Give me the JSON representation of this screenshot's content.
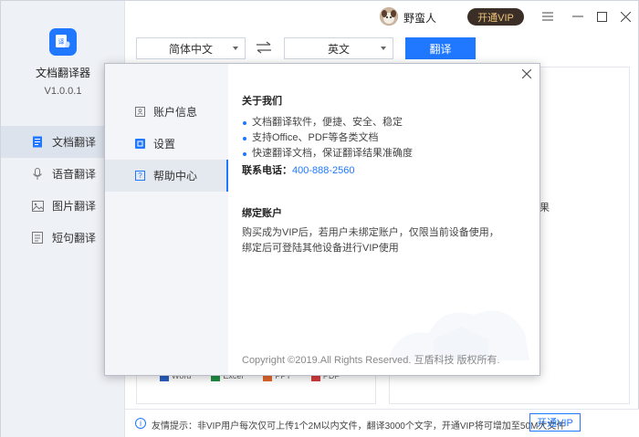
{
  "app": {
    "name": "文档翻译器",
    "version": "V1.0.0.1"
  },
  "sidebar": {
    "items": [
      {
        "label": "文档翻译",
        "icon": "document-icon",
        "active": true
      },
      {
        "label": "语音翻译",
        "icon": "microphone-icon",
        "active": false
      },
      {
        "label": "图片翻译",
        "icon": "image-icon",
        "active": false
      },
      {
        "label": "短句翻译",
        "icon": "text-icon",
        "active": false
      }
    ]
  },
  "titlebar": {
    "username": "野蛮人",
    "vip_label": "开通VIP"
  },
  "langbar": {
    "source": "简体中文",
    "target": "英文",
    "translate_label": "翻译"
  },
  "filetypes": [
    "Word",
    "Excel",
    "PPT",
    "PDF"
  ],
  "peek_text": "果",
  "tipbar": {
    "text": "友情提示：非VIP用户每次仅可上传1个2M以内文件，翻译3000个文字，开通VIP将可增加至50M大文件",
    "vip_label": "开通VIP"
  },
  "dialog": {
    "menu": [
      {
        "label": "账户信息",
        "icon": "account-icon",
        "active": false
      },
      {
        "label": "设置",
        "icon": "settings-icon",
        "active": false
      },
      {
        "label": "帮助中心",
        "icon": "help-icon",
        "active": true
      }
    ],
    "about": {
      "title": "关于我们",
      "bullets": [
        "文档翻译软件，便捷、安全、稳定",
        "支持Office、PDF等各类文档",
        "快速翻译文档，保证翻译结果准确度"
      ],
      "contact_label": "联系电话：",
      "contact_phone": "400-888-2560"
    },
    "bind": {
      "title": "绑定账户",
      "text": "购买成为VIP后，若用户未绑定账户，仅限当前设备使用，绑定后可登陆其他设备进行VIP使用"
    },
    "copyright": "Copyright ©2019.All Rights Reserved. 互盾科技 版权所有."
  },
  "colors": {
    "accent": "#1f78ff",
    "vip_bg": "#3a2e26",
    "vip_text": "#f1c57a"
  }
}
